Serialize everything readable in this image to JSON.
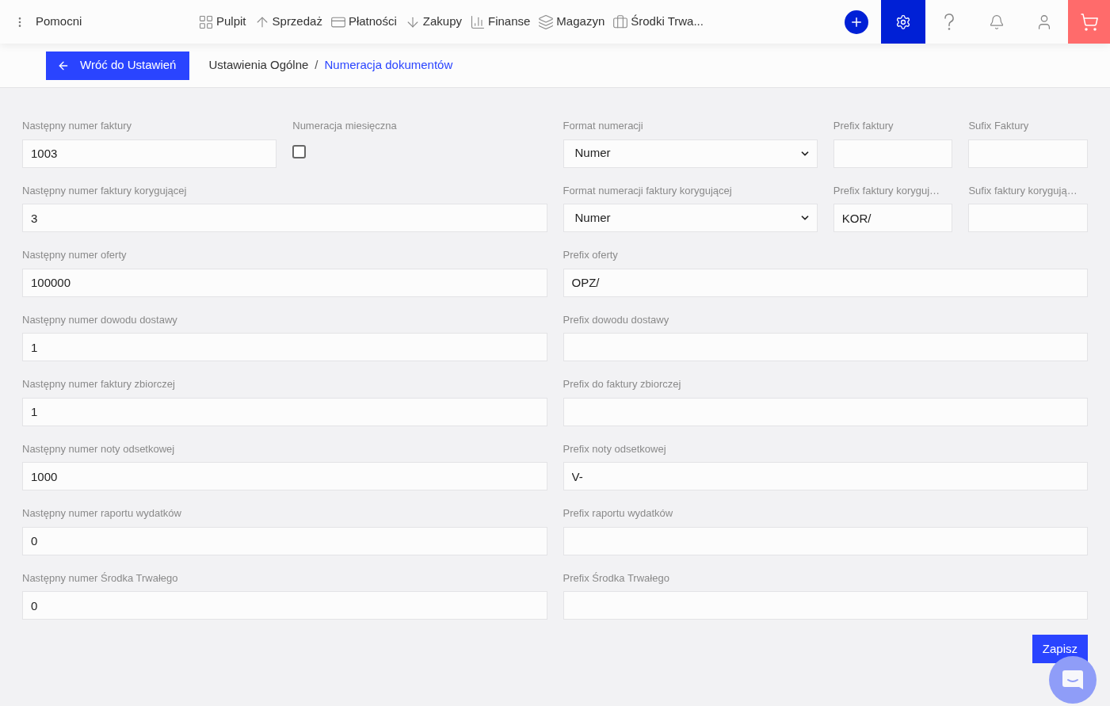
{
  "header": {
    "menu_label": "Pomocni",
    "nav": [
      {
        "label": "Pulpit",
        "kind": "dashboard"
      },
      {
        "label": "Sprzedaż",
        "kind": "up"
      },
      {
        "label": "Płatności",
        "kind": "payment"
      },
      {
        "label": "Zakupy",
        "kind": "down"
      },
      {
        "label": "Finanse",
        "kind": "bars"
      },
      {
        "label": "Magazyn",
        "kind": "stack"
      },
      {
        "label": "Środki Trwa...",
        "kind": "briefcase"
      }
    ]
  },
  "subheader": {
    "back_button": "Wróć do Ustawień",
    "breadcrumb": [
      "Ustawienia Ogólne",
      "Numeracja dokumentów"
    ],
    "separator": "/"
  },
  "rows": [
    {
      "fields": [
        {
          "kind": "text",
          "label": "Następny numer faktury",
          "value": "1003"
        },
        {
          "kind": "checkbox",
          "label": "Numeracja miesięczna",
          "checked": false
        },
        {
          "kind": "select",
          "label": "Format numeracji",
          "value": "Numer"
        },
        {
          "kind": "text",
          "label": "Prefix faktury"
        },
        {
          "kind": "text",
          "label": "Sufix Faktury"
        }
      ]
    },
    {
      "fields": [
        {
          "kind": "text",
          "label": "Następny numer faktury korygującej",
          "value": "3"
        },
        {
          "kind": "select",
          "label": "Format numeracji faktury korygującej",
          "value": "Numer"
        },
        {
          "kind": "text",
          "label": "Prefix faktury koryguj…",
          "value": "KOR/"
        },
        {
          "kind": "text",
          "label": "Sufix faktury korygują…"
        }
      ]
    },
    {
      "fields": [
        {
          "kind": "text",
          "label": "Następny numer oferty",
          "value": "100000"
        },
        {
          "kind": "text",
          "label": "Prefix oferty",
          "value": "OPZ/"
        }
      ]
    },
    {
      "fields": [
        {
          "kind": "text",
          "label": "Następny numer dowodu dostawy",
          "value": "1"
        },
        {
          "kind": "text",
          "label": "Prefix dowodu dostawy"
        }
      ]
    },
    {
      "fields": [
        {
          "kind": "text",
          "label": "Następny numer faktury zbiorczej",
          "value": "1"
        },
        {
          "kind": "text",
          "label": "Prefix do faktury zbiorczej"
        }
      ]
    },
    {
      "fields": [
        {
          "kind": "text",
          "label": "Następny numer noty odsetkowej",
          "value": "1000"
        },
        {
          "kind": "text",
          "label": "Prefix noty odsetkowej",
          "value": "V-"
        }
      ]
    },
    {
      "fields": [
        {
          "kind": "text",
          "label": "Następny numer raportu wydatków",
          "value": "0"
        },
        {
          "kind": "text",
          "label": "Prefix raportu wydatków"
        }
      ]
    },
    {
      "fields": [
        {
          "kind": "text",
          "label": "Następny numer Środka Trwałego",
          "value": "0"
        },
        {
          "kind": "text",
          "label": "Prefix Środka Trwałego"
        }
      ]
    }
  ],
  "save_button": "Zapisz"
}
